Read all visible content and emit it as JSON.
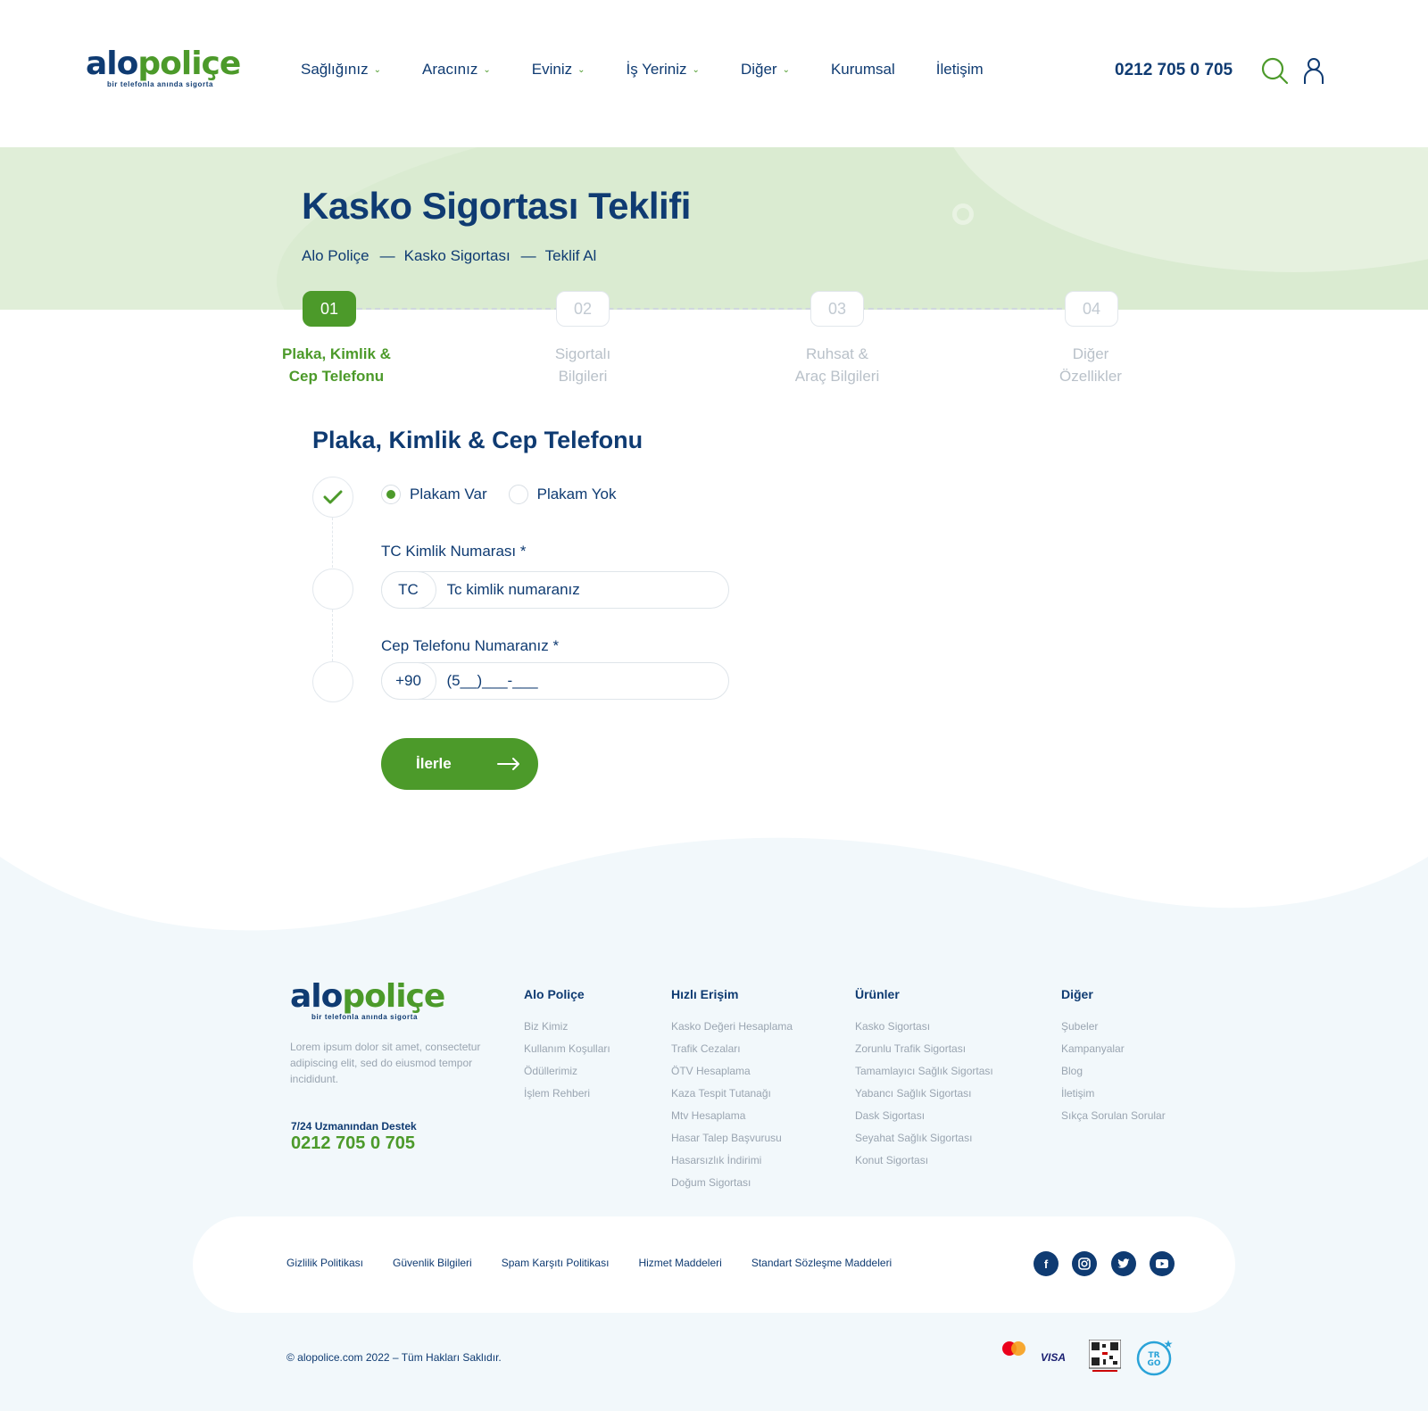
{
  "brand": {
    "logo_part1": "alo",
    "logo_part2": "poliçe",
    "tagline": "bir telefonla anında sigorta"
  },
  "nav": [
    {
      "label": "Sağlığınız",
      "dropdown": true
    },
    {
      "label": "Aracınız",
      "dropdown": true
    },
    {
      "label": "Eviniz",
      "dropdown": true
    },
    {
      "label": "İş Yeriniz",
      "dropdown": true
    },
    {
      "label": "Diğer",
      "dropdown": true
    },
    {
      "label": "Kurumsal",
      "dropdown": false
    },
    {
      "label": "İletişim",
      "dropdown": false
    }
  ],
  "header": {
    "phone": "0212 705 0 705",
    "icons": [
      "search-icon",
      "user-icon"
    ]
  },
  "hero": {
    "title": "Kasko Sigortası Teklifi",
    "breadcrumb": [
      "Alo Poliçe",
      "Kasko Sigortası",
      "Teklif Al"
    ],
    "separator": "—"
  },
  "steps": [
    {
      "number": "01",
      "line1": "Plaka, Kimlik &",
      "line2": "Cep Telefonu",
      "active": true
    },
    {
      "number": "02",
      "line1": "Sigortalı",
      "line2": "Bilgileri",
      "active": false
    },
    {
      "number": "03",
      "line1": "Ruhsat &",
      "line2": "Araç Bilgileri",
      "active": false
    },
    {
      "number": "04",
      "line1": "Diğer",
      "line2": "Özellikler",
      "active": false
    }
  ],
  "form": {
    "title": "Plaka, Kimlik & Cep Telefonu",
    "plate_options": [
      {
        "label": "Plakam Var",
        "selected": true
      },
      {
        "label": "Plakam Yok",
        "selected": false
      }
    ],
    "tc": {
      "label": "TC Kimlik Numarası *",
      "prefix": "TC",
      "placeholder": "Tc kimlik numaranız"
    },
    "phone": {
      "label": "Cep Telefonu Numaranız *",
      "prefix": "+90",
      "placeholder": "(5__)___-___"
    },
    "next_button": "İlerle"
  },
  "footer": {
    "description": "Lorem ipsum dolor sit amet, consectetur adipiscing elit, sed do eiusmod tempor incididunt.",
    "support_label": "7/24 Uzmanından Destek",
    "support_phone": "0212 705 0 705",
    "columns": [
      {
        "title": "Alo Poliçe",
        "links": [
          "Biz Kimiz",
          "Kullanım Koşulları",
          "Ödüllerimiz",
          "İşlem Rehberi"
        ]
      },
      {
        "title": "Hızlı Erişim",
        "links": [
          "Kasko Değeri Hesaplama",
          "Trafik Cezaları",
          "ÖTV Hesaplama",
          "Kaza Tespit Tutanağı",
          "Mtv Hesaplama",
          "Hasar Talep Başvurusu",
          "Hasarsızlık İndirimi",
          "Doğum Sigortası"
        ]
      },
      {
        "title": "Ürünler",
        "links": [
          "Kasko Sigortası",
          "Zorunlu Trafik Sigortası",
          "Tamamlayıcı Sağlık Sigortası",
          "Yabancı Sağlık Sigortası",
          "Dask Sigortası",
          "Seyahat Sağlık Sigortası",
          "Konut Sigortası"
        ]
      },
      {
        "title": "Diğer",
        "links": [
          "Şubeler",
          "Kampanyalar",
          "Blog",
          "İletişim",
          "Sıkça Sorulan Sorular"
        ]
      }
    ],
    "legal_links": [
      "Gizlilik Politikası",
      "Güvenlik Bilgileri",
      "Spam Karşıtı Politikası",
      "Hizmet Maddeleri",
      "Standart Sözleşme Maddeleri"
    ],
    "social": [
      "facebook-icon",
      "instagram-icon",
      "twitter-icon",
      "youtube-icon"
    ],
    "copyright": "© alopolice.com 2022 – Tüm Hakları Saklıdır.",
    "payment": {
      "mastercard": "MasterCard",
      "visa": "VISA",
      "etbis": "ETBİS Kayıtlıdır",
      "trgo": "TR GO"
    }
  },
  "colors": {
    "primary": "#0f3b72",
    "accent": "#4c9a2a",
    "hero_bg": "#e0eed8",
    "footer_bg": "#f2f8fb"
  }
}
